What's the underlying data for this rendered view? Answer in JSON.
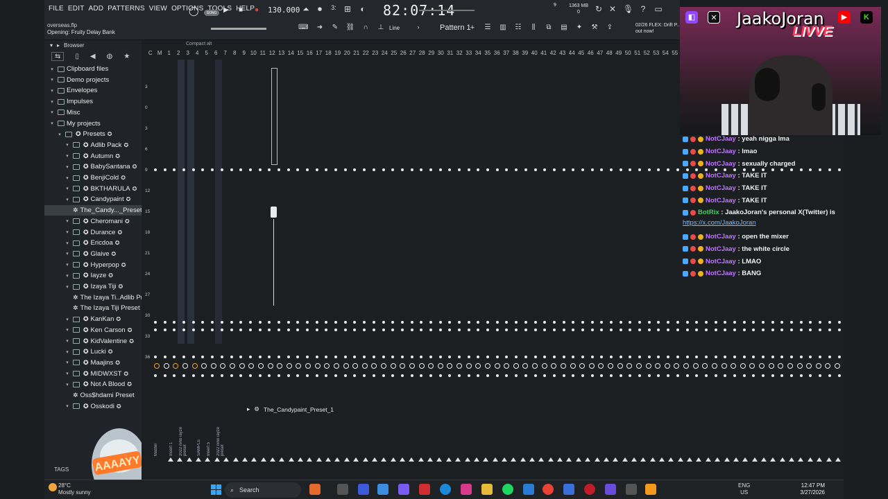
{
  "menus": [
    "FILE",
    "EDIT",
    "ADD",
    "PATTERNS",
    "VIEW",
    "OPTIONS",
    "TOOLS",
    "HELP"
  ],
  "project": {
    "file": "overseas.flp",
    "hint": "Opening: Fruity Delay Bank"
  },
  "transport": {
    "song_toggle": "SONG",
    "tempo": "130.000",
    "time": "82:07:14",
    "cpu": "9",
    "memory": "1363 MB",
    "mem_sub": "0"
  },
  "toolbar": {
    "snap": "Line",
    "pattern": "Pattern 1",
    "news": "02/26 FLEX: Drift P... out now!"
  },
  "browser": {
    "title": "Browser",
    "tags_label": "TAGS",
    "items": [
      {
        "label": "Clipboard files",
        "type": "folder",
        "indent": 0
      },
      {
        "label": "Demo projects",
        "type": "folder",
        "indent": 0
      },
      {
        "label": "Envelopes",
        "type": "folder",
        "indent": 0
      },
      {
        "label": "Impulses",
        "type": "folder",
        "indent": 0
      },
      {
        "label": "Misc",
        "type": "folder",
        "indent": 0
      },
      {
        "label": "My projects",
        "type": "folder",
        "indent": 0
      },
      {
        "label": "Presets",
        "type": "preset",
        "indent": 1
      },
      {
        "label": "Adlib Pack",
        "type": "preset",
        "indent": 2
      },
      {
        "label": "Autumn",
        "type": "preset",
        "indent": 2
      },
      {
        "label": "BabySantana",
        "type": "preset",
        "indent": 2
      },
      {
        "label": "BenjiCold",
        "type": "preset",
        "indent": 2
      },
      {
        "label": "BKTHARULA",
        "type": "preset",
        "indent": 2
      },
      {
        "label": "Candypaint",
        "type": "preset",
        "indent": 2
      },
      {
        "label": "The_Candy..._Preset_1",
        "type": "file",
        "indent": 3
      },
      {
        "label": "Cheromani",
        "type": "preset",
        "indent": 2
      },
      {
        "label": "Durance",
        "type": "preset",
        "indent": 2
      },
      {
        "label": "Ericdoa",
        "type": "preset",
        "indent": 2
      },
      {
        "label": "Glaive",
        "type": "preset",
        "indent": 2
      },
      {
        "label": "Hyperpop",
        "type": "preset",
        "indent": 2
      },
      {
        "label": "Iayze",
        "type": "preset",
        "indent": 2
      },
      {
        "label": "Izaya Tiji",
        "type": "preset",
        "indent": 2
      },
      {
        "label": "The Izaya Ti..Adlib Preset",
        "type": "file",
        "indent": 3
      },
      {
        "label": "The Izaya Tiji Preset",
        "type": "file",
        "indent": 3
      },
      {
        "label": "KanKan",
        "type": "preset",
        "indent": 2
      },
      {
        "label": "Ken Carson",
        "type": "preset",
        "indent": 2
      },
      {
        "label": "KidValentine",
        "type": "preset",
        "indent": 2
      },
      {
        "label": "Lucki",
        "type": "preset",
        "indent": 2
      },
      {
        "label": "Maajins",
        "type": "preset",
        "indent": 2
      },
      {
        "label": "MIDWXST",
        "type": "preset",
        "indent": 2
      },
      {
        "label": "Not A Blood",
        "type": "preset",
        "indent": 2
      },
      {
        "label": "Oss$hdami Preset",
        "type": "file",
        "indent": 3
      },
      {
        "label": "Osskodi",
        "type": "preset",
        "indent": 2
      }
    ]
  },
  "mixer": {
    "compact_label": "Compact alt",
    "db_labels": [
      "3",
      "0",
      "3",
      "6",
      "9",
      "12",
      "15",
      "18",
      "21",
      "24",
      "27",
      "30",
      "33",
      "36"
    ],
    "selected_preset": "The_Candypaint_Preset_1",
    "insert_labels": [
      "Master",
      "Insert 1",
      "2022 nino iayze preset",
      "SAMPLE",
      "Insert 5",
      "2022 nino iayze preset"
    ]
  },
  "stream": {
    "name": "JaakoJoran",
    "live": "LIVVE",
    "chat": [
      {
        "user": "NotCJaay",
        "msg": "yeah nigga Ima"
      },
      {
        "user": "NotCJaay",
        "msg": "lmao"
      },
      {
        "user": "NotCJaay",
        "msg": "sexually charged"
      },
      {
        "user": "NotCJaay",
        "msg": "TAKE IT"
      },
      {
        "user": "NotCJaay",
        "msg": "TAKE IT"
      },
      {
        "user": "NotCJaay",
        "msg": "TAKE IT"
      },
      {
        "user": "BotRix",
        "msg": "JaakoJoran's personal X(Twitter) is",
        "bot": true,
        "link": "https://x.com/JaakoJoran"
      },
      {
        "user": "NotCJaay",
        "msg": "open the mixer"
      },
      {
        "user": "NotCJaay",
        "msg": "the white circle"
      },
      {
        "user": "NotCJaay",
        "msg": "LMAO"
      },
      {
        "user": "NotCJaay",
        "msg": "BANG"
      }
    ]
  },
  "taskbar": {
    "temp": "28°C",
    "weather": "Mostly sunny",
    "search": "Search",
    "lang": "ENG",
    "region": "US",
    "time": "12:47 PM",
    "date": "3/27/2026"
  },
  "colors": {
    "accent": "#f0a030",
    "rec": "#e0443a",
    "chat_user": "#c073ff",
    "bot_user": "#41d160"
  }
}
